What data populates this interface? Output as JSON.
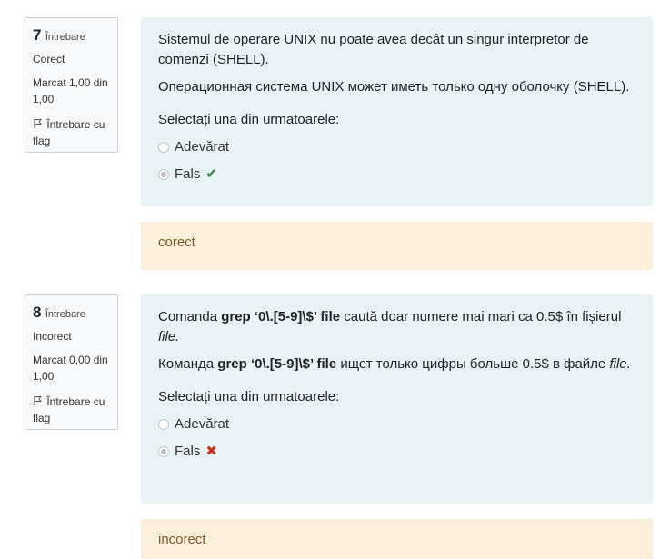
{
  "questions": [
    {
      "number": "7",
      "number_word": "Întrebare",
      "state": "Corect",
      "grade": "Marcat 1,00 din 1,00",
      "flag_label": "Întrebare cu flag",
      "text_ro": "Sistemul de operare UNIX nu poate avea decât un singur interpretor de comenzi (SHELL).",
      "text_ru": "Операционная система UNIX может иметь только одну оболочку (SHELL).",
      "prompt": "Selectați una din urmatoarele:",
      "answers": [
        {
          "label": "Adevărat",
          "checked": false
        },
        {
          "label": "Fals",
          "checked": true,
          "mark": "✔"
        }
      ],
      "feedback": "corect"
    },
    {
      "number": "8",
      "number_word": "Întrebare",
      "state": "Incorect",
      "grade": "Marcat 0,00 din 1,00",
      "flag_label": "Întrebare cu flag",
      "text_ro_prefix": "Comanda ",
      "command": "grep  ‘0\\.[5-9]\\$’ file",
      "text_ro_suffix": "  caută doar numere mai mari ca 0.5$ în fișierul ",
      "file_word_ro": "file.",
      "text_ru_prefix": "  Команда ",
      "text_ru_suffix": "  ищет только цифры больше 0.5$ в файле ",
      "file_word_ru": "file.",
      "prompt": "Selectați una din urmatoarele:",
      "answers": [
        {
          "label": "Adevărat",
          "checked": false
        },
        {
          "label": "Fals",
          "checked": true,
          "mark": "✖"
        }
      ],
      "feedback": "incorect"
    }
  ]
}
